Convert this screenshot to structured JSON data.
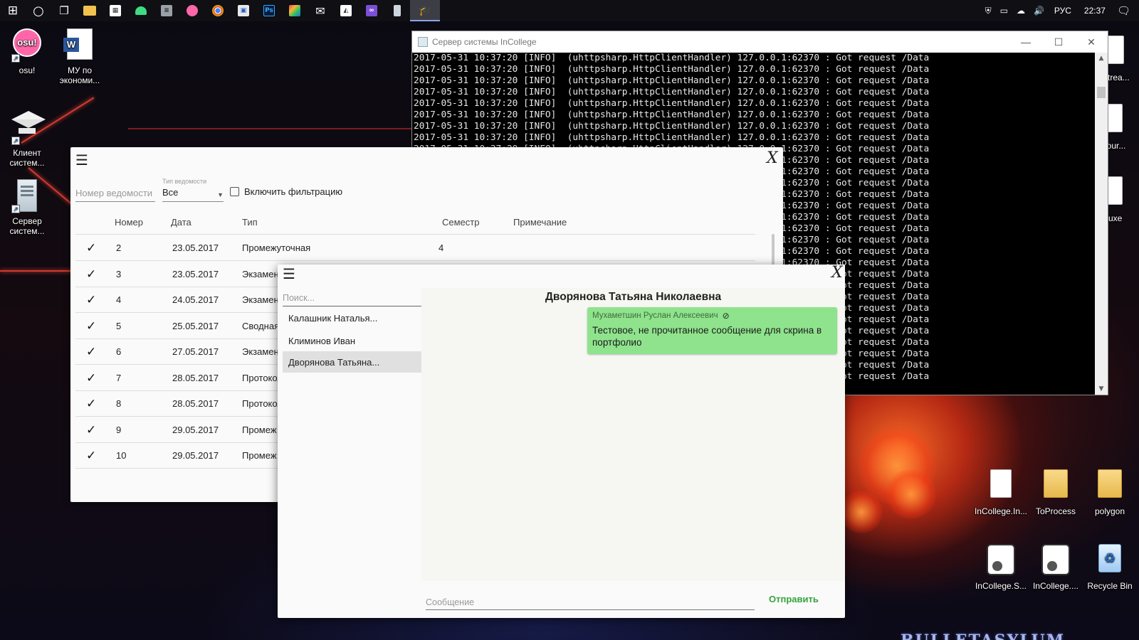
{
  "taskbar": {
    "pinned": [
      {
        "name": "start-button",
        "glyph": "⊞"
      },
      {
        "name": "cortana-button",
        "glyph": "○"
      },
      {
        "name": "task-view-button",
        "glyph": "❐"
      },
      {
        "name": "file-explorer-icon",
        "glyph": "▬"
      },
      {
        "name": "store-icon",
        "glyph": "▦"
      },
      {
        "name": "android-icon",
        "glyph": "▲"
      },
      {
        "name": "database-icon",
        "glyph": "≡"
      },
      {
        "name": "osu-icon",
        "glyph": "●"
      },
      {
        "name": "chrome-icon",
        "glyph": "◉"
      },
      {
        "name": "app-icon",
        "glyph": "▣"
      },
      {
        "name": "photoshop-icon",
        "glyph": "Ps"
      },
      {
        "name": "paint-icon",
        "glyph": "▧"
      },
      {
        "name": "mail-icon",
        "glyph": "✉"
      },
      {
        "name": "photos-icon",
        "glyph": "▨"
      },
      {
        "name": "visual-studio-icon",
        "glyph": "∧"
      },
      {
        "name": "server-icon",
        "glyph": "▯"
      },
      {
        "name": "incollege-client-icon",
        "glyph": "⌂"
      }
    ],
    "tray": {
      "language": "РУС",
      "time": "22:37",
      "icons": [
        "shield-icon",
        "network-icon",
        "cloud-icon",
        "volume-icon"
      ]
    }
  },
  "desktop": {
    "icons": [
      {
        "label": "osu!",
        "kind": "osu",
        "shortcut": true
      },
      {
        "label": "МУ по экономи...",
        "kind": "word",
        "shortcut": false
      },
      {
        "label": "Клиент систем...",
        "kind": "cap",
        "shortcut": true
      },
      {
        "label": "Сервер систем...",
        "kind": "server",
        "shortcut": true
      },
      {
        "label": "eStrea...",
        "kind": "paper",
        "shortcut": false
      },
      {
        "label": "-Sour...",
        "kind": "paper",
        "shortcut": false
      },
      {
        "label": "eluxe",
        "kind": "paper",
        "shortcut": false
      },
      {
        "label": "InCollege.In...",
        "kind": "paper",
        "shortcut": false
      },
      {
        "label": "ToProcess",
        "kind": "folder",
        "shortcut": false
      },
      {
        "label": "polygon",
        "kind": "folder",
        "shortcut": false
      },
      {
        "label": "InCollege.S...",
        "kind": "app",
        "shortcut": false
      },
      {
        "label": "InCollege....",
        "kind": "app",
        "shortcut": false
      },
      {
        "label": "Recycle Bin",
        "kind": "recycle",
        "shortcut": false
      }
    ],
    "background_logo": "BULLETASYLUM"
  },
  "console": {
    "title": "Сервер системы InCollege",
    "visible_line": "2017-05-31 10:37:20 [INFO]  (uhttpsharp.HttpClientHandler) 127.0.0.1:62370 : Got request /Data",
    "full_lines_above": 8,
    "partial_tail": ".0.1:62370 : Got request /Data",
    "partial_tail_count": 12,
    "short_tail": "Got request /Data",
    "short_tail_count": 9
  },
  "statements": {
    "filter_number_placeholder": "Номер ведомости",
    "filter_type_caption": "Тип ведомости",
    "filter_type_value": "Все",
    "filter_checkbox_label": "Включить фильтрацию",
    "columns": [
      "Номер",
      "Дата",
      "Тип",
      "Семестр",
      "Примечание"
    ],
    "rows": [
      {
        "number": "2",
        "date": "23.05.2017",
        "type": "Промежуточная",
        "semester": "4",
        "note": ""
      },
      {
        "number": "3",
        "date": "23.05.2017",
        "type": "Экзамен",
        "semester": "",
        "note": ""
      },
      {
        "number": "4",
        "date": "24.05.2017",
        "type": "Экзамен",
        "semester": "",
        "note": ""
      },
      {
        "number": "5",
        "date": "25.05.2017",
        "type": "Сводная",
        "semester": "",
        "note": ""
      },
      {
        "number": "6",
        "date": "27.05.2017",
        "type": "Экзамен",
        "semester": "",
        "note": ""
      },
      {
        "number": "7",
        "date": "28.05.2017",
        "type": "Протокол",
        "semester": "",
        "note": ""
      },
      {
        "number": "8",
        "date": "28.05.2017",
        "type": "Протокол",
        "semester": "",
        "note": ""
      },
      {
        "number": "9",
        "date": "29.05.2017",
        "type": "Промеж",
        "semester": "",
        "note": ""
      },
      {
        "number": "10",
        "date": "29.05.2017",
        "type": "Промеж",
        "semester": "",
        "note": ""
      }
    ]
  },
  "messages": {
    "search_placeholder": "Поиск...",
    "contacts": [
      {
        "name": "Калашник Наталья...",
        "selected": false
      },
      {
        "name": "Климинов Иван",
        "selected": false
      },
      {
        "name": "Дворянова Татьяна...",
        "selected": true
      }
    ],
    "chat_title": "Дворянова Татьяна Николаевна",
    "message": {
      "author": "Мухаметшин Руслан Алексеевич",
      "text": "Тестовое, не прочитанное сообщение для скрина в портфолио",
      "unread_icon": "eye-off-icon"
    },
    "input_placeholder": "Сообщение",
    "send_label": "Отправить"
  },
  "colors": {
    "bubble": "#8fe38d",
    "send": "#35a23c",
    "accent_line": "#d23a2e"
  }
}
